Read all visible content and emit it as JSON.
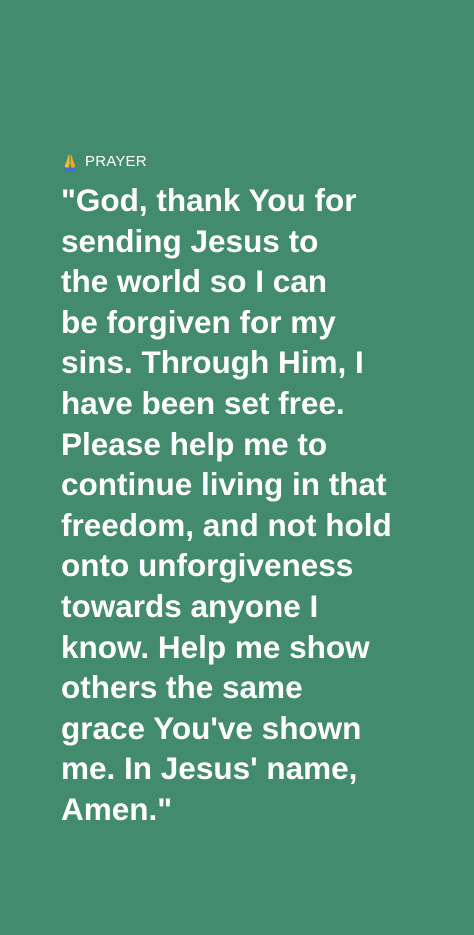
{
  "background_color": "#438b6d",
  "text_color": "#ffffff",
  "label": {
    "icon": "folded-hands-icon",
    "text": "PRAYER"
  },
  "prayer": {
    "lines": [
      "\"God, thank You for",
      "sending Jesus to",
      "the world so I can",
      "be forgiven for my",
      "sins. Through Him, I",
      "have been set free.",
      "Please help me to",
      "continue living in that",
      "freedom, and not hold",
      "onto unforgiveness",
      "towards anyone I",
      "know. Help me show",
      "others the same",
      "grace You've shown",
      "me. In Jesus' name,",
      "Amen.\""
    ]
  }
}
